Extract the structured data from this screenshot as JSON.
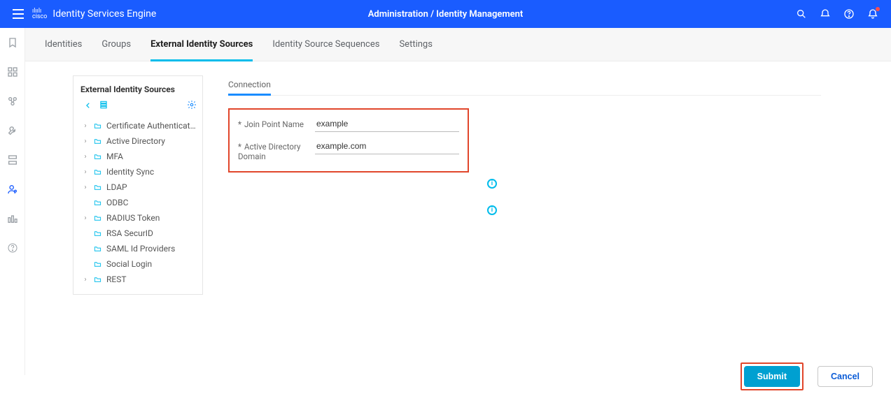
{
  "header": {
    "product": "Identity Services Engine",
    "brand_small": "cisco",
    "breadcrumb": "Administration / Identity Management"
  },
  "tabs": {
    "items": [
      {
        "label": "Identities",
        "active": false
      },
      {
        "label": "Groups",
        "active": false
      },
      {
        "label": "External Identity Sources",
        "active": true
      },
      {
        "label": "Identity Source Sequences",
        "active": false
      },
      {
        "label": "Settings",
        "active": false
      }
    ]
  },
  "tree": {
    "title": "External Identity Sources",
    "items": [
      {
        "label": "Certificate Authenticat...",
        "expandable": true
      },
      {
        "label": "Active Directory",
        "expandable": true
      },
      {
        "label": "MFA",
        "expandable": true
      },
      {
        "label": "Identity Sync",
        "expandable": true
      },
      {
        "label": "LDAP",
        "expandable": true
      },
      {
        "label": "ODBC",
        "expandable": false
      },
      {
        "label": "RADIUS Token",
        "expandable": true
      },
      {
        "label": "RSA SecurID",
        "expandable": false
      },
      {
        "label": "SAML Id Providers",
        "expandable": false
      },
      {
        "label": "Social Login",
        "expandable": false
      },
      {
        "label": "REST",
        "expandable": true
      }
    ]
  },
  "detail": {
    "tabs": [
      {
        "label": "Connection",
        "active": true
      }
    ],
    "fields": {
      "join_point_label": "Join Point Name",
      "join_point_value": "example",
      "ad_domain_label": "Active Directory Domain",
      "ad_domain_value": "example.com"
    }
  },
  "buttons": {
    "submit": "Submit",
    "cancel": "Cancel"
  },
  "colors": {
    "accent_blue": "#1a5cff",
    "cyan": "#00bceb",
    "highlight_red": "#e1462b",
    "submit_blue": "#00a0d1"
  }
}
